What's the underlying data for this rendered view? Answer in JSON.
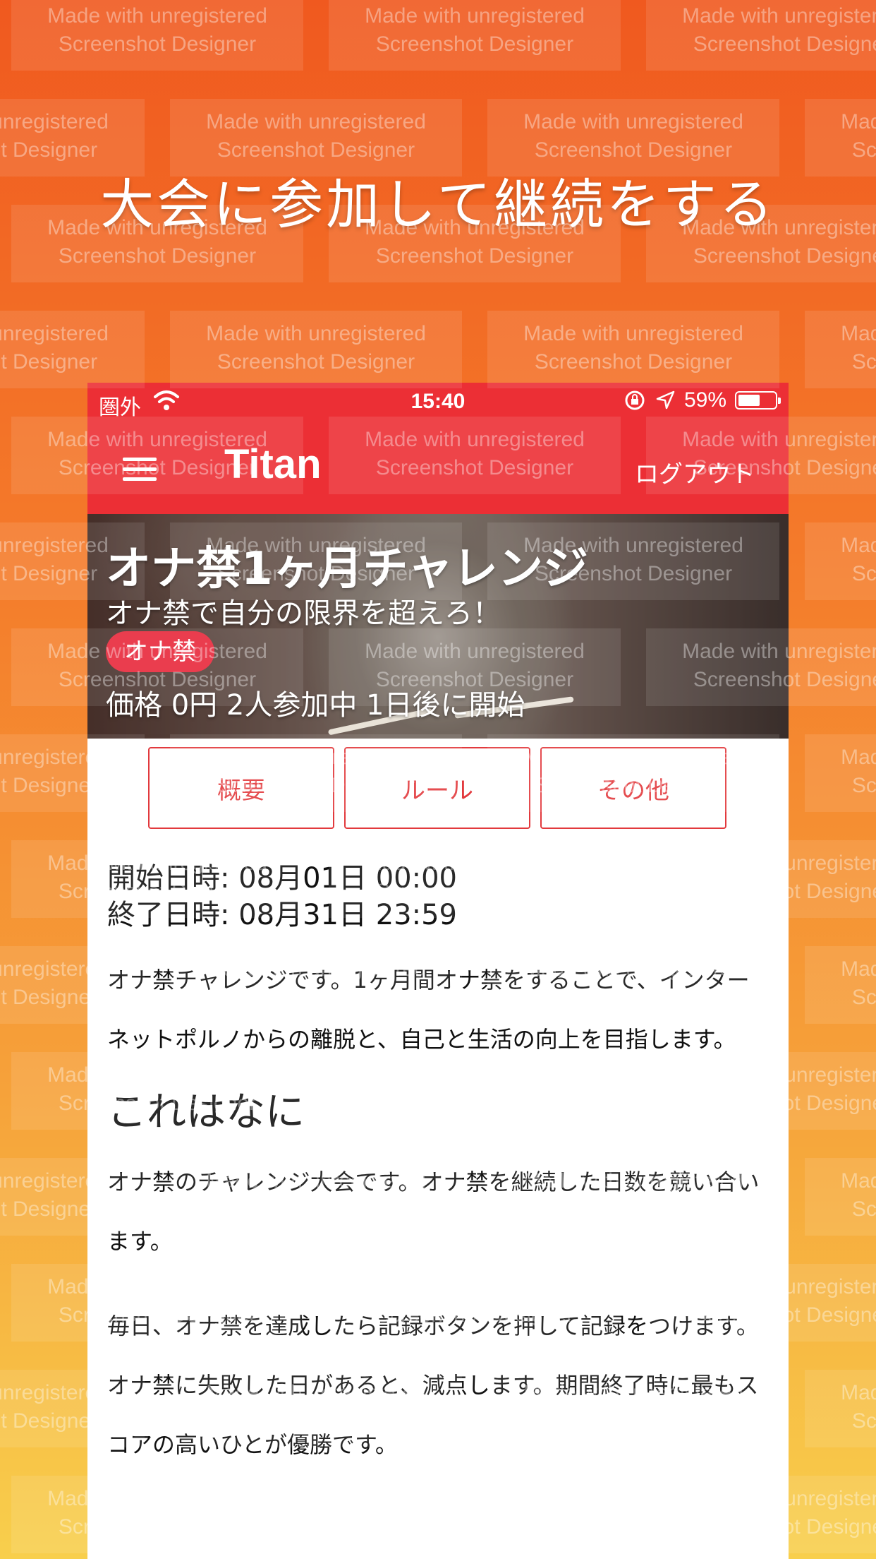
{
  "headline": "大会に参加して継続をする",
  "watermark_text": "Made with unregistered\nScreenshot Designer",
  "status_bar": {
    "carrier": "圏外",
    "time": "15:40",
    "battery_percent": "59%",
    "battery_level": 0.59,
    "icons": [
      "wifi-icon",
      "rotation-lock-icon",
      "location-arrow-icon",
      "battery-icon"
    ]
  },
  "nav": {
    "title": "Titan",
    "logout": "ログアウト",
    "menu_icon": "hamburger-menu-icon"
  },
  "hero": {
    "title": "オナ禁1ヶ月チャレンジ",
    "subtitle": "オナ禁で自分の限界を超えろ！",
    "tag": "オナ禁",
    "meta": "価格 0円 2人参加中 1日後に開始"
  },
  "tabs": [
    "概要",
    "ルール",
    "その他"
  ],
  "details": {
    "start": "開始日時: 08月01日 00:00",
    "end": "終了日時: 08月31日 23:59",
    "description": "オナ禁チャレンジです。1ヶ月間オナ禁をすることで、インターネットポルノからの離脱と、自己と生活の向上を目指します。",
    "section_heading": "これはなに",
    "section_body_1": "オナ禁のチャレンジ大会です。オナ禁を継続した日数を競い合います。",
    "section_body_2": "毎日、オナ禁を達成したら記録ボタンを押して記録をつけます。オナ禁に失敗した日があると、減点します。期間終了時に最もスコアの高いひとが優勝です。"
  },
  "colors": {
    "accent_red": "#ec2f35",
    "tab_border": "#e2393d",
    "badge_red": "#e8283a",
    "bg_top": "#f0591f",
    "bg_bottom": "#f8cf4c"
  }
}
